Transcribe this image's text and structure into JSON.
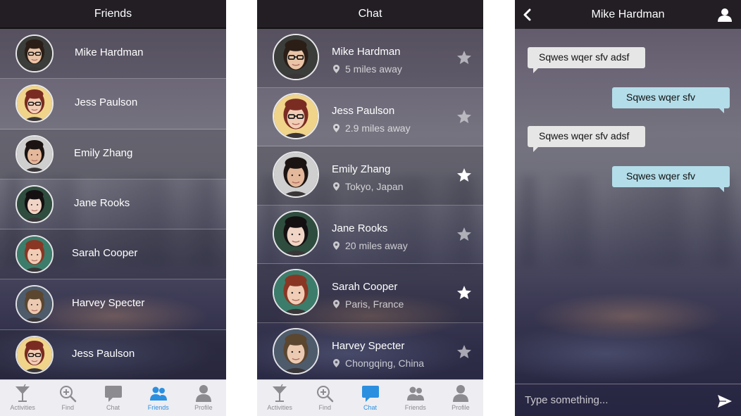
{
  "friends_screen": {
    "title": "Friends",
    "friends": [
      {
        "name": "Mike Hardman"
      },
      {
        "name": "Jess Paulson"
      },
      {
        "name": "Emily Zhang"
      },
      {
        "name": "Jane Rooks"
      },
      {
        "name": "Sarah Cooper"
      },
      {
        "name": "Harvey Specter"
      },
      {
        "name": "Jess Paulson"
      }
    ],
    "tabs": [
      {
        "label": "Activities",
        "icon": "cocktail-icon",
        "active": false
      },
      {
        "label": "Find",
        "icon": "search-plus-icon",
        "active": false
      },
      {
        "label": "Chat",
        "icon": "chat-bubble-icon",
        "active": false
      },
      {
        "label": "Friends",
        "icon": "friends-icon",
        "active": true
      },
      {
        "label": "Profile",
        "icon": "profile-icon",
        "active": false
      }
    ]
  },
  "chat_list_screen": {
    "title": "Chat",
    "contacts": [
      {
        "name": "Mike Hardman",
        "location": "5 miles away",
        "starred": false
      },
      {
        "name": "Jess Paulson",
        "location": "2.9 miles away",
        "starred": false
      },
      {
        "name": "Emily Zhang",
        "location": "Tokyo, Japan",
        "starred": true
      },
      {
        "name": "Jane Rooks",
        "location": "20 miles away",
        "starred": false
      },
      {
        "name": "Sarah Cooper",
        "location": "Paris, France",
        "starred": true
      },
      {
        "name": "Harvey Specter",
        "location": "Chongqing, China",
        "starred": false
      }
    ],
    "tabs": [
      {
        "label": "Activities",
        "icon": "cocktail-icon",
        "active": false
      },
      {
        "label": "Find",
        "icon": "search-plus-icon",
        "active": false
      },
      {
        "label": "Chat",
        "icon": "chat-bubble-icon",
        "active": true
      },
      {
        "label": "Friends",
        "icon": "friends-icon",
        "active": false
      },
      {
        "label": "Profile",
        "icon": "profile-icon",
        "active": false
      }
    ]
  },
  "conversation_screen": {
    "title": "Mike Hardman",
    "messages": [
      {
        "text": "Sqwes wqer sfv adsf",
        "direction": "incoming"
      },
      {
        "text": "Sqwes wqer sfv",
        "direction": "outgoing"
      },
      {
        "text": "Sqwes wqer sfv adsf",
        "direction": "incoming"
      },
      {
        "text": "Sqwes wqer sfv",
        "direction": "outgoing"
      }
    ],
    "composer": {
      "placeholder": "Type something...",
      "value": ""
    }
  },
  "colors": {
    "header_bg": "#221e24",
    "tab_active": "#2b8fe0",
    "tab_inactive": "#8b8b90",
    "bubble_incoming": "#e6e6e6",
    "bubble_outgoing": "#b3dde9"
  }
}
